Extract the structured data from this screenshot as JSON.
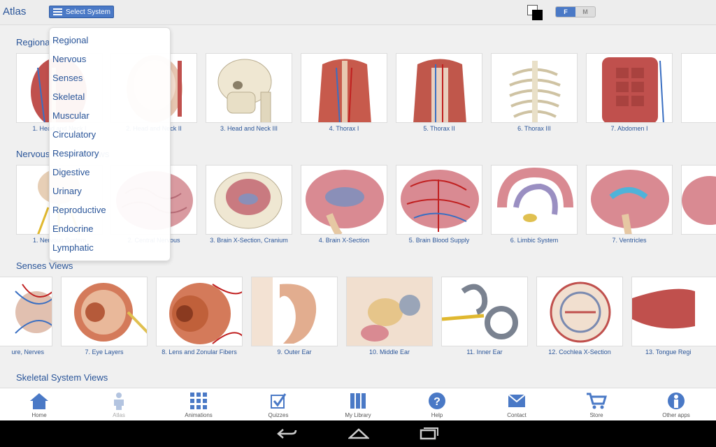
{
  "app": {
    "title": "Atlas"
  },
  "toolbar": {
    "select_system": "Select System",
    "toggle_f": "F",
    "toggle_m": "M"
  },
  "menu": {
    "items": [
      "Regional",
      "Nervous",
      "Senses",
      "Skeletal",
      "Muscular",
      "Circulatory",
      "Respiratory",
      "Digestive",
      "Urinary",
      "Reproductive",
      "Endocrine",
      "Lymphatic"
    ]
  },
  "sections": [
    {
      "title": "Regional Views",
      "cards": [
        "1. Head and Neck I",
        "2. Head and Neck II",
        "3. Head and Neck III",
        "4. Thorax I",
        "5. Thorax II",
        "6. Thorax III",
        "7. Abdomen I"
      ]
    },
    {
      "title": "Nervous System Views",
      "cards": [
        "1. Nervous System",
        "2. Central Nervous",
        "3. Brain X-Section, Cranium",
        "4. Brain X-Section",
        "5. Brain Blood Supply",
        "6. Limbic System",
        "7. Ventricles"
      ]
    },
    {
      "title": "Senses Views",
      "cards": [
        "ure, Nerves",
        "7. Eye Layers",
        "8. Lens and Zonular Fibers",
        "9. Outer Ear",
        "10. Middle Ear",
        "11. Inner Ear",
        "12. Cochlea X-Section",
        "13. Tongue Regi"
      ]
    },
    {
      "title": "Skeletal System Views"
    }
  ],
  "nav": {
    "items": [
      {
        "label": "Home",
        "icon": "home-icon"
      },
      {
        "label": "Atlas",
        "icon": "body-icon"
      },
      {
        "label": "Animations",
        "icon": "grid-icon"
      },
      {
        "label": "Quizzes",
        "icon": "checkbox-icon"
      },
      {
        "label": "My Library",
        "icon": "library-icon"
      },
      {
        "label": "Help",
        "icon": "help-icon"
      },
      {
        "label": "Contact",
        "icon": "envelope-icon"
      },
      {
        "label": "Store",
        "icon": "cart-icon"
      },
      {
        "label": "Other apps",
        "icon": "person-icon"
      }
    ]
  },
  "colors": {
    "accent": "#4a79c6",
    "text": "#2a5599",
    "muscle": "#c0504d",
    "bone": "#efe7d2"
  }
}
